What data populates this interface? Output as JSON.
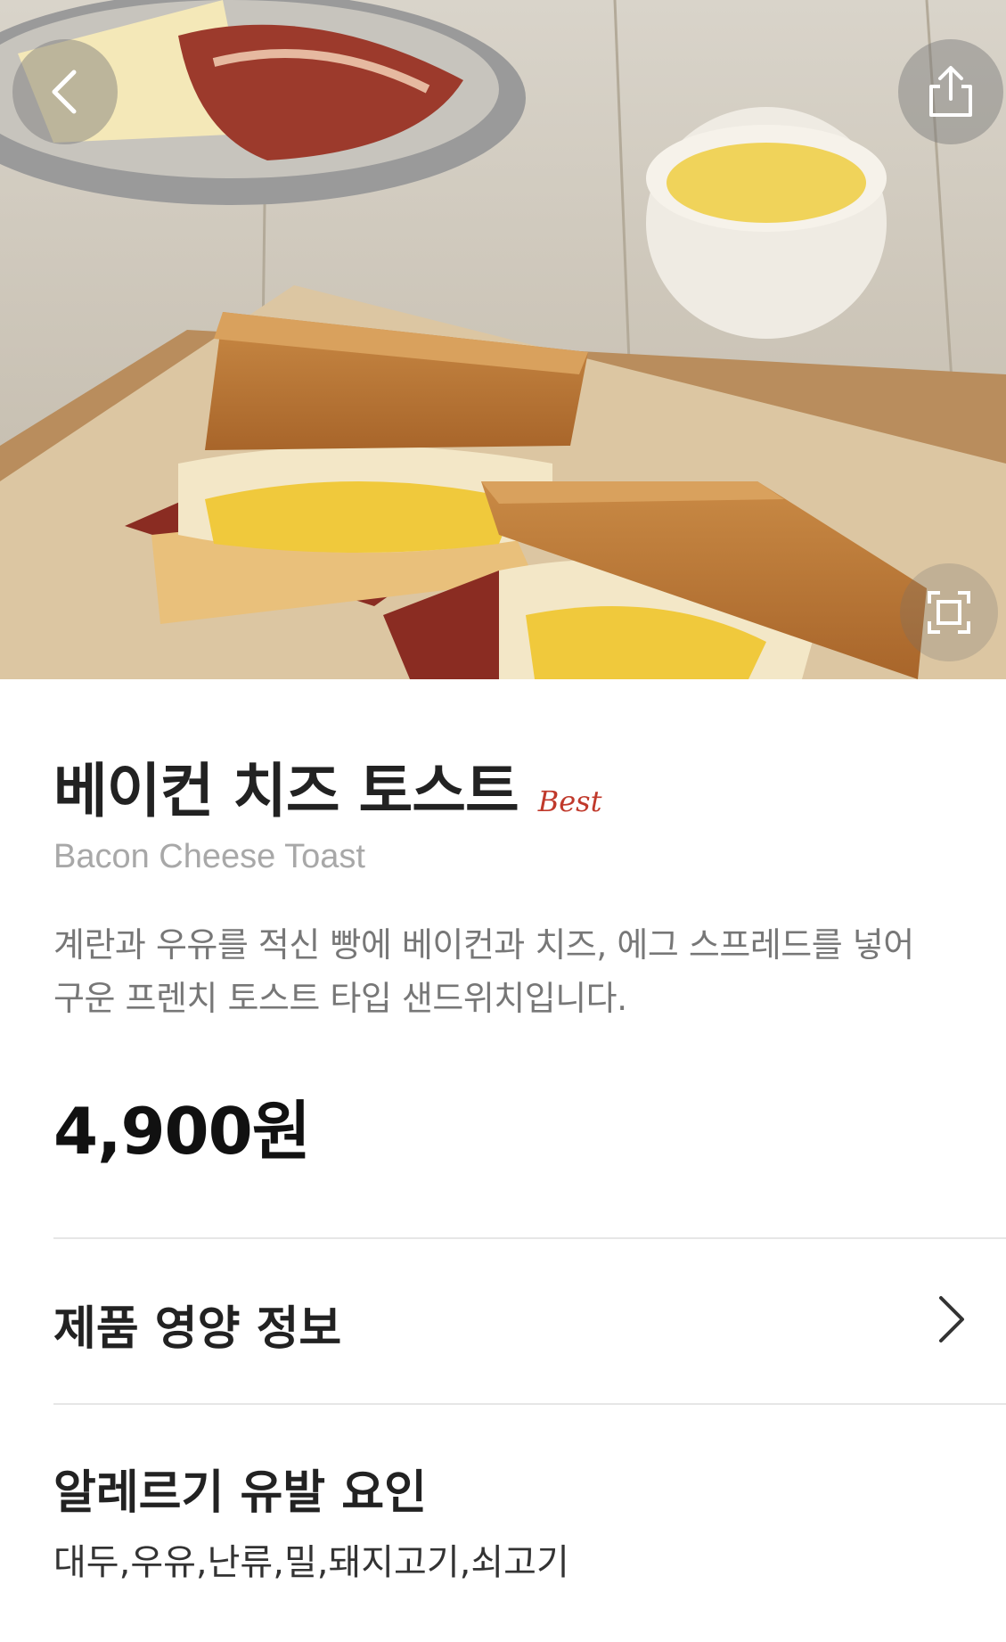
{
  "product": {
    "name": "베이컨 치즈 토스트",
    "badge": "Best",
    "name_en": "Bacon Cheese Toast",
    "description": "계란과 우유를 적신 빵에 베이컨과 치즈, 에그 스프레드를 넣어 구운 프렌치 토스트 타입 샌드위치입니다.",
    "price": "4,900원"
  },
  "sections": {
    "nutrition_label": "제품 영양 정보",
    "allergy_title": "알레르기 유발 요인",
    "allergy_values": "대두,우유,난류,밀,돼지고기,쇠고기"
  },
  "icons": {
    "back": "chevron-left-icon",
    "share": "share-icon",
    "zoom": "expand-icon",
    "nutrition_arrow": "chevron-right-icon"
  },
  "colors": {
    "badge": "#c0392b",
    "subtitle": "#a8a8a8",
    "description": "#777777",
    "divider": "#e6e6e6"
  }
}
